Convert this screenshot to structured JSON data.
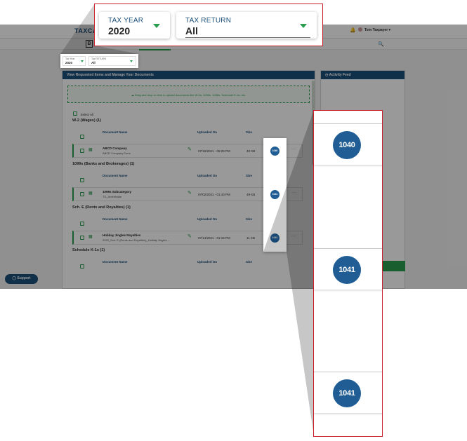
{
  "app": {
    "logo": "TAXCA",
    "user_name": "Tom Taxpayer ▾",
    "subbar_button": "B"
  },
  "filters": {
    "tax_year_label": "TAX YEAR",
    "tax_year_value": "2020",
    "tax_return_label": "TAX RETURN",
    "tax_return_value": "All"
  },
  "mini_filters": {
    "tax_year_label": "Tax Year",
    "tax_year_value": "2020",
    "tax_return_label": "Tax RETURN",
    "tax_return_value": "All"
  },
  "documents_panel": {
    "title": "View Requested Items and Manage Your Documents",
    "dropzone_text": "Drag and drop or click to upload documents like W-2s, 1099s, 1098s, Schedule K-1s, etc.",
    "select_all": "Select All",
    "columns": {
      "name": "Document Name",
      "uploaded": "Uploaded On",
      "size": "Size"
    },
    "sections": [
      {
        "title": "W-2 (Wages) (1)",
        "rows": [
          {
            "name": "ABCD Company",
            "sub": "ABCD Company Form",
            "date": "07/15/2021 - 05:25 PM",
            "size": "40 KB",
            "badge": "1040"
          }
        ]
      },
      {
        "title": "1099s (Banks and Brokerages) (1)",
        "rows": [
          {
            "name": "1099s Subcategory",
            "sub": "TD_Ameritrade",
            "date": "07/02/2021 - 01:43 PM",
            "size": "49 KB",
            "badge": "1041"
          }
        ]
      },
      {
        "title": "Sch. E (Rents and Royalties) (1)",
        "rows": [
          {
            "name": "Holiday Jingles Royalties",
            "sub": "2020_Sch. E (Rents and Royalties)_Holiday Jingles ...",
            "date": "07/14/2021 - 01:15 PM",
            "size": "11 KB",
            "badge": "1041"
          }
        ]
      },
      {
        "title": "Schedule K-1s (1)",
        "rows": []
      }
    ]
  },
  "activity_feed": {
    "title": "Activity Feed"
  },
  "support": {
    "label": "Support"
  },
  "zoom_badges": [
    "1040",
    "1041",
    "1041"
  ],
  "colors": {
    "primary": "#1b4f7a",
    "accent": "#2a9d4f",
    "badge": "#1f5d94",
    "callout": "#c8202c"
  },
  "icons": [
    "bell-icon",
    "search-icon",
    "upload-cloud-icon",
    "document-icon",
    "pencil-icon",
    "more-icon",
    "chat-icon",
    "caret-down-icon",
    "clock-icon"
  ]
}
